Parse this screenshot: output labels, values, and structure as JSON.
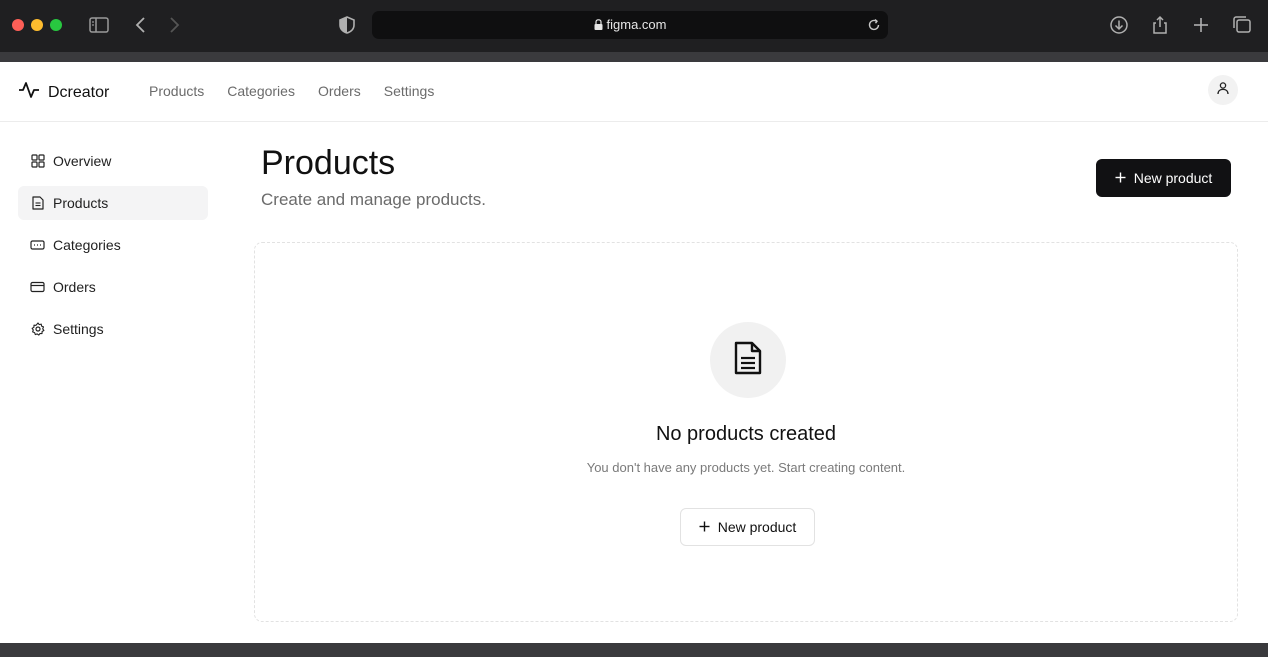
{
  "browser": {
    "url": "figma.com"
  },
  "app": {
    "brand": "Dcreator",
    "topnav": [
      "Products",
      "Categories",
      "Orders",
      "Settings"
    ],
    "sidebar": [
      {
        "label": "Overview",
        "icon": "grid-icon",
        "active": false
      },
      {
        "label": "Products",
        "icon": "document-icon",
        "active": true
      },
      {
        "label": "Categories",
        "icon": "tag-icon",
        "active": false
      },
      {
        "label": "Orders",
        "icon": "card-icon",
        "active": false
      },
      {
        "label": "Settings",
        "icon": "gear-icon",
        "active": false
      }
    ],
    "page": {
      "title": "Products",
      "subtitle": "Create and manage products.",
      "new_button": "New product"
    },
    "empty_state": {
      "title": "No products created",
      "description": "You don't have any products yet. Start creating content.",
      "button": "New product"
    }
  },
  "colors": {
    "primary_button": "#111113",
    "muted_text": "#6b6b6b",
    "active_item_bg": "#f4f4f5"
  }
}
